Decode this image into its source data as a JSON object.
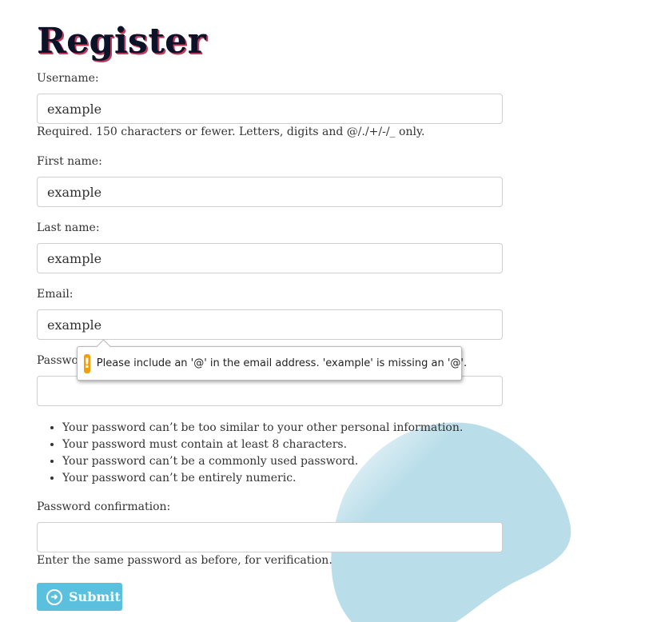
{
  "page": {
    "title": "Register"
  },
  "fields": {
    "username": {
      "label": "Username:",
      "value": "example",
      "help": "Required. 150 characters or fewer. Letters, digits and @/./+/-/_ only."
    },
    "first_name": {
      "label": "First name:",
      "value": "example"
    },
    "last_name": {
      "label": "Last name:",
      "value": "example"
    },
    "email": {
      "label": "Email:",
      "value": "example"
    },
    "password": {
      "label": "Password:",
      "value": ""
    },
    "password_confirmation": {
      "label": "Password confirmation:",
      "value": "",
      "help": "Enter the same password as before, for verification."
    }
  },
  "password_rules": [
    "Your password can’t be too similar to your other personal information.",
    "Your password must contain at least 8 characters.",
    "Your password can’t be a commonly used password.",
    "Your password can’t be entirely numeric."
  ],
  "validation_tooltip": {
    "icon": "warning-icon",
    "message": "Please include an '@' in the email address. 'example' is missing an '@'."
  },
  "submit": {
    "label": "Submit",
    "icon": "arrow-circle-right-icon"
  },
  "colors": {
    "button": "#5bc0de",
    "warning": "#f29e0d",
    "blob": "#b9dde9",
    "title": "#0c1228"
  }
}
